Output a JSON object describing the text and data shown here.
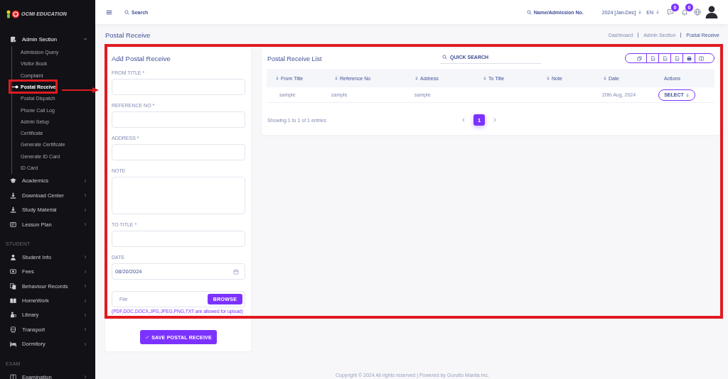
{
  "sidebar": {
    "logo": {
      "text": "OCMI EDUCATION"
    },
    "sections": [
      {
        "items": [
          {
            "label": "Admin Section",
            "expanded": true,
            "children": [
              {
                "label": "Admission Query",
                "selected": false
              },
              {
                "label": "Visitor Book",
                "selected": false
              },
              {
                "label": "Complaint",
                "selected": false
              },
              {
                "label": "Postal Receive",
                "selected": true
              },
              {
                "label": "Postal Dispatch",
                "selected": false
              },
              {
                "label": "Phone Call Log",
                "selected": false
              },
              {
                "label": "Admin Setup",
                "selected": false
              },
              {
                "label": "Certificate",
                "selected": false
              },
              {
                "label": "Generate Certificate",
                "selected": false
              },
              {
                "label": "Generate ID Card",
                "selected": false
              },
              {
                "label": "ID Card",
                "selected": false
              }
            ]
          },
          {
            "label": "Academics",
            "expanded": false
          },
          {
            "label": "Download Center",
            "expanded": false
          },
          {
            "label": "Study Material",
            "expanded": false
          },
          {
            "label": "Lesson Plan",
            "expanded": false
          }
        ]
      },
      {
        "heading": "STUDENT",
        "items": [
          {
            "label": "Student Info",
            "expanded": false
          },
          {
            "label": "Fees",
            "expanded": false
          },
          {
            "label": "Behaviour Records",
            "expanded": false
          },
          {
            "label": "HomeWork",
            "expanded": false
          },
          {
            "label": "Library",
            "expanded": false
          },
          {
            "label": "Transport",
            "expanded": false
          },
          {
            "label": "Dormitory",
            "expanded": false
          }
        ]
      },
      {
        "heading": "EXAM",
        "items": [
          {
            "label": "Examination",
            "expanded": false
          }
        ]
      }
    ]
  },
  "topbar": {
    "search": {
      "placeholder": "Search"
    },
    "student_search": {
      "placeholder": "Name/Admission No."
    },
    "session": "2024 [Jan-Dec]",
    "language": "EN",
    "messages_badge": "0",
    "notifications_badge": "0"
  },
  "page_header": {
    "title": "Postal Receive",
    "breadcrumb": [
      "Dashboard",
      "Admin Section",
      "Postal Receive"
    ]
  },
  "form": {
    "title": "Add Postal Receive",
    "fields": [
      {
        "kind": "text",
        "label": "FROM TITLE *"
      },
      {
        "kind": "text",
        "label": "REFERENCE NO *"
      },
      {
        "kind": "text",
        "label": "ADDRESS *"
      },
      {
        "kind": "textarea",
        "label": "NOTE"
      },
      {
        "kind": "text",
        "label": "TO TITLE *"
      },
      {
        "kind": "date",
        "label": "DATE",
        "value": "08/20/2024"
      },
      {
        "kind": "file",
        "placeholder": "File",
        "button": "BROWSE",
        "hint": "(PDF,DOC,DOCX,JPG,JPEG,PNG,TXT are allowed for upload)"
      }
    ],
    "submit": "SAVE POSTAL RECEIVE"
  },
  "list": {
    "title": "Postal Receive List",
    "quick_search": {
      "placeholder": "QUICK SEARCH"
    },
    "columns": [
      {
        "label": "From Title",
        "sortable": true
      },
      {
        "label": "Reference No",
        "sortable": true
      },
      {
        "label": "Address",
        "sortable": true
      },
      {
        "label": "To Title",
        "sortable": true
      },
      {
        "label": "Note",
        "sortable": true
      },
      {
        "label": "Date",
        "sortable": true
      },
      {
        "label": "Actions",
        "sortable": false
      }
    ],
    "rows": [
      {
        "from_title": "sample",
        "reference_no": "sample",
        "address": "sample",
        "date": "20th Aug, 2024",
        "action": "SELECT"
      }
    ],
    "entries_info": "Showing 1 to 1 of 1 entries",
    "pagination": {
      "pages": [
        {
          "label": "1",
          "selected": true
        }
      ]
    }
  },
  "footer": "Copyright © 2024 All rights reserved | Powered by Gurutto Manila Inc."
}
